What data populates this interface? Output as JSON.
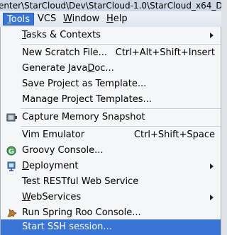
{
  "window": {
    "path_title": "enter\\StarCloud\\Dev\\StarCloud-1.0\\StarCloud_x64_DEV2\\s"
  },
  "menubar": {
    "items": [
      {
        "label": "Tools",
        "mnemonic": "T",
        "rest": "ools",
        "active": true
      },
      {
        "label": "VCS",
        "mnemonic": "",
        "rest": "VCS",
        "active": false
      },
      {
        "label": "Window",
        "mnemonic": "W",
        "rest": "indow",
        "active": false
      },
      {
        "label": "Help",
        "mnemonic": "H",
        "rest": "elp",
        "active": false
      }
    ]
  },
  "tools_menu": {
    "items": [
      {
        "label": "Tasks & Contexts",
        "pre": "",
        "mn": "T",
        "post": "asks & Contexts",
        "shortcut": "",
        "submenu": true
      },
      {
        "label": "New Scratch File...",
        "pre": "New Scratch File...",
        "mn": "",
        "post": "",
        "shortcut": "Ctrl+Alt+Shift+Insert",
        "submenu": false
      },
      {
        "label": "Generate JavaDoc...",
        "pre": "Generate Java",
        "mn": "D",
        "post": "oc...",
        "shortcut": "",
        "submenu": false
      },
      {
        "label": "Save Project as Template...",
        "pre": "Save Project as Template...",
        "mn": "",
        "post": "",
        "shortcut": "",
        "submenu": false
      },
      {
        "label": "Manage Project Templates...",
        "pre": "Manage Project Templates...",
        "mn": "",
        "post": "",
        "shortcut": "",
        "submenu": false
      },
      {
        "label": "Capture Memory Snapshot",
        "pre": "Capture Memory Snapshot",
        "mn": "",
        "post": "",
        "shortcut": "",
        "submenu": false,
        "icon": "memory-snapshot-icon"
      },
      {
        "label": "Vim Emulator",
        "pre": "Vim Emulator",
        "mn": "",
        "post": "",
        "shortcut": "Ctrl+Shift+Space",
        "submenu": false
      },
      {
        "label": "Groovy Console...",
        "pre": "Groovy Console...",
        "mn": "",
        "post": "",
        "shortcut": "",
        "submenu": false,
        "icon": "groovy-icon"
      },
      {
        "label": "Deployment",
        "pre": "",
        "mn": "D",
        "post": "eployment",
        "shortcut": "",
        "submenu": true,
        "icon": "deployment-icon"
      },
      {
        "label": "Test RESTful Web Service",
        "pre": "Test RESTful Web Service",
        "mn": "",
        "post": "",
        "shortcut": "",
        "submenu": false
      },
      {
        "label": "WebServices",
        "pre": "",
        "mn": "W",
        "post": "ebServices",
        "shortcut": "",
        "submenu": true
      },
      {
        "label": "Run Spring Roo Console...",
        "pre": "Run Spring Roo Console...",
        "mn": "",
        "post": "",
        "shortcut": "",
        "submenu": false,
        "icon": "spring-roo-icon"
      },
      {
        "label": "Start SSH session...",
        "pre": "Start SSH session...",
        "mn": "",
        "post": "",
        "shortcut": "",
        "submenu": false,
        "selected": true
      }
    ]
  },
  "colors": {
    "selection": "#3875d7",
    "menu_bg": "#f5f6f7",
    "menubar_bg": "#e6ebf2"
  }
}
